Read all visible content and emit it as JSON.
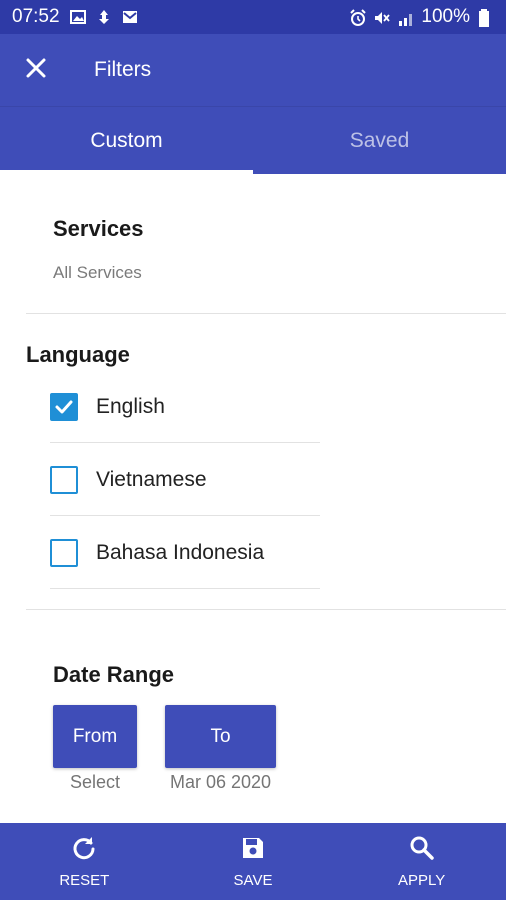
{
  "status_bar": {
    "time": "07:52",
    "battery_text": "100%",
    "left_icons": [
      "image-icon",
      "app-icon",
      "mail-icon"
    ],
    "right_icons": [
      "alarm-icon",
      "mute-icon",
      "signal-icon",
      "battery-icon"
    ]
  },
  "app_bar": {
    "title": "Filters",
    "close_icon": "close-icon"
  },
  "tabs": [
    {
      "label": "Custom",
      "active": true
    },
    {
      "label": "Saved",
      "active": false
    }
  ],
  "services": {
    "title": "Services",
    "value": "All Services"
  },
  "language": {
    "title": "Language",
    "options": [
      {
        "label": "English",
        "checked": true
      },
      {
        "label": "Vietnamese",
        "checked": false
      },
      {
        "label": "Bahasa Indonesia",
        "checked": false
      }
    ]
  },
  "date_range": {
    "title": "Date Range",
    "from_label": "From",
    "from_value": "Select",
    "to_label": "To",
    "to_value": "Mar 06 2020"
  },
  "bottom_bar": {
    "reset_label": "RESET",
    "save_label": "SAVE",
    "apply_label": "APPLY"
  },
  "colors": {
    "primary": "#3f4db8",
    "status_bar": "#2e3aa6",
    "checkbox": "#1f8fd6"
  }
}
